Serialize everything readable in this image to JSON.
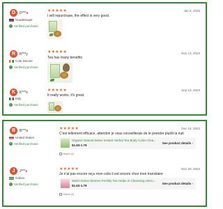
{
  "colors": {
    "frame": "#2e8b2e",
    "star": "#f26a21",
    "verified": "#3a8a3a",
    "avatar": "#e0532f"
  },
  "icons": {
    "star": "star-icon",
    "verified": "check-circle-icon",
    "helpful": "thumbs-up-icon",
    "chevron": "chevron-right-icon"
  },
  "reviews_top": [
    {
      "avatar_letter": "D",
      "name": "D***a",
      "country": "Guadeloupe",
      "verified": "Verified purchase",
      "stars": "★★★★★",
      "date": "Jan 8, 2025",
      "text": "I will repurchase, the effect is very good."
    },
    {
      "avatar_letter": "R",
      "name": "R***y",
      "country": "Cote Divoire",
      "verified": "Verified purchase",
      "stars": "★★★★★",
      "date": "Nov 13, 2023",
      "text": "Tea has many benefits"
    },
    {
      "avatar_letter": "K",
      "name": "K***e",
      "country": "Italy",
      "verified": "Verified purchase",
      "stars": "★★★★★",
      "date": "Sep 13, 2023",
      "text": "It really works, it's great."
    }
  ],
  "reviews_bottom": [
    {
      "avatar_letter": "B",
      "name": "B***a",
      "country": "United States",
      "verified": "Verified purchase",
      "stars": "★★★★★",
      "date": "Dec 15, 2023",
      "text": "C'est tellement efficace, attention je vous conseillerais de le prendre plutôt la nuit",
      "product_title": "Organic Natural Detox Instant Herbal Tea Body Colon Clea...",
      "price": "$1.63-1.79",
      "see_details": "See product details",
      "helpful": "Helpful (0)"
    },
    {
      "avatar_letter": "J",
      "name": "J***a",
      "country": "Gabon",
      "verified": "Verified purchase",
      "stars": "★★★★★",
      "date": "Nov 29, 2023",
      "text": "Je n'ai pas encore reçu mon colis il est encore chez mon transitaire",
      "product_title": "Warm Detox Women Fertility Tea Helps in Cleansing Uteru...",
      "price": "$1.63-1.79",
      "see_details": "See product details",
      "helpful": "Helpful (0)"
    }
  ]
}
